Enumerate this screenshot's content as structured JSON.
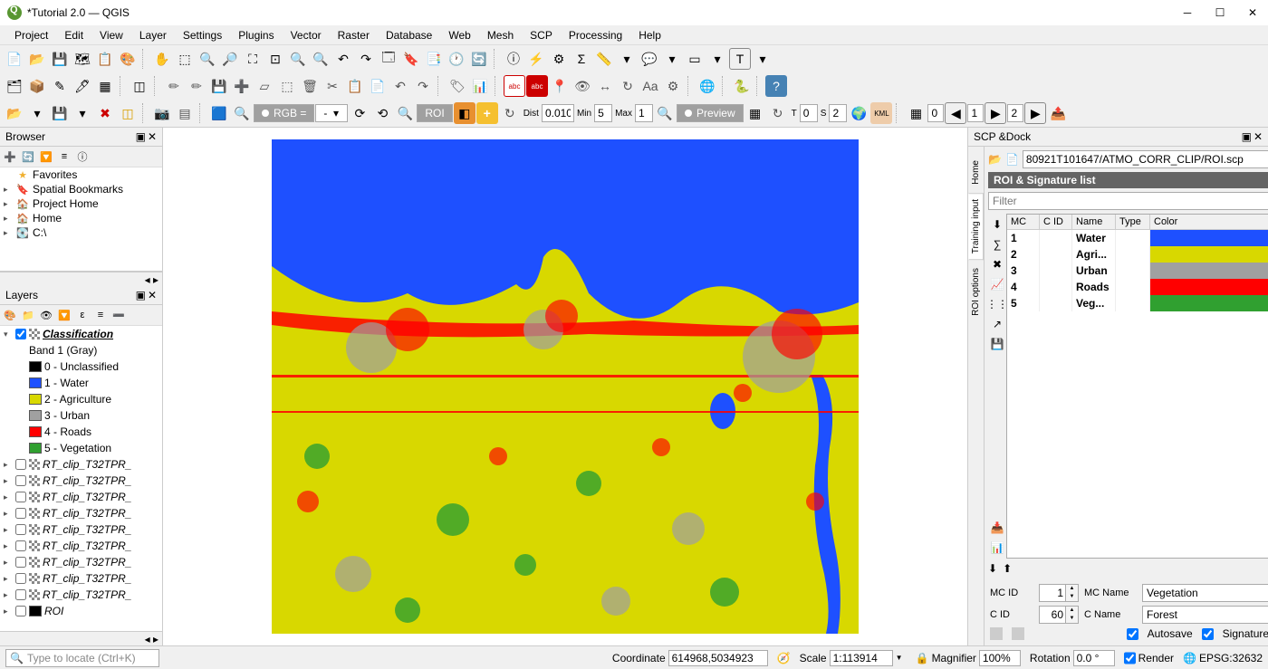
{
  "window": {
    "title": "*Tutorial 2.0 — QGIS"
  },
  "menus": [
    "Project",
    "Edit",
    "View",
    "Layer",
    "Settings",
    "Plugins",
    "Vector",
    "Raster",
    "Database",
    "Web",
    "Mesh",
    "SCP",
    "Processing",
    "Help"
  ],
  "toolbar3": {
    "rgb_label": "RGB = ",
    "roi_label": "ROI",
    "dist_label": "Dist",
    "dist_val": "0.010",
    "min_label": "Min",
    "min_val": "5",
    "max_label": "Max",
    "max_val": "1",
    "preview_label": "Preview",
    "s_label": "S",
    "s_val": "2",
    "t_label": "T",
    "t_val": "0"
  },
  "browser": {
    "title": "Browser",
    "items": [
      {
        "icon": "star",
        "label": "Favorites",
        "color": "#f0b030"
      },
      {
        "icon": "bookmark",
        "label": "Spatial Bookmarks",
        "color": "#888"
      },
      {
        "icon": "home",
        "label": "Project Home",
        "color": "#4a9"
      },
      {
        "icon": "home2",
        "label": "Home",
        "color": "#888"
      },
      {
        "icon": "drive",
        "label": "C:\\",
        "color": "#888"
      }
    ]
  },
  "layers": {
    "title": "Layers",
    "classification": {
      "name": "Classification",
      "band": "Band 1 (Gray)"
    },
    "classes": [
      {
        "label": "0 - Unclassified",
        "color": "#000000"
      },
      {
        "label": "1 - Water",
        "color": "#1e50ff"
      },
      {
        "label": "2 - Agriculture",
        "color": "#d8d800"
      },
      {
        "label": "3 - Urban",
        "color": "#a0a0a0"
      },
      {
        "label": "4 - Roads",
        "color": "#ff0000"
      },
      {
        "label": "5 - Vegetation",
        "color": "#30a030"
      }
    ],
    "rt_layers": [
      "RT_clip_T32TPR_",
      "RT_clip_T32TPR_",
      "RT_clip_T32TPR_",
      "RT_clip_T32TPR_",
      "RT_clip_T32TPR_",
      "RT_clip_T32TPR_",
      "RT_clip_T32TPR_",
      "RT_clip_T32TPR_",
      "RT_clip_T32TPR_"
    ],
    "roi_layer": "ROI"
  },
  "scp": {
    "title": "SCP &Dock",
    "tabs": [
      "Home",
      "Training input",
      "ROI options"
    ],
    "file_path": "80921T101647/ATMO_CORR_CLIP/ROI.scp",
    "sig_header": "ROI & Signature list",
    "filter_placeholder": "Filter",
    "columns": [
      "MC",
      "C ID",
      "Name",
      "Type",
      "Color"
    ],
    "rows": [
      {
        "mc": "1",
        "cid": "",
        "name": "Water",
        "type": "",
        "color": "#1e50ff"
      },
      {
        "mc": "2",
        "cid": "",
        "name": "Agri...",
        "type": "",
        "color": "#d8d800"
      },
      {
        "mc": "3",
        "cid": "",
        "name": "Urban",
        "type": "",
        "color": "#a0a0a0"
      },
      {
        "mc": "4",
        "cid": "",
        "name": "Roads",
        "type": "",
        "color": "#ff0000"
      },
      {
        "mc": "5",
        "cid": "",
        "name": "Veg...",
        "type": "",
        "color": "#30a030"
      }
    ],
    "mcid_label": "MC ID",
    "mcid_val": "1",
    "mcname_label": "MC Name",
    "mcname_val": "Vegetation",
    "cid_label": "C ID",
    "cid_val": "60",
    "cname_label": "C Name",
    "cname_val": "Forest",
    "autosave": "Autosave",
    "signature": "Signature"
  },
  "status": {
    "locator_placeholder": "Type to locate (Ctrl+K)",
    "coord_label": "Coordinate",
    "coord_val": "614968,5034923",
    "scale_label": "Scale",
    "scale_val": "1:113914",
    "mag_label": "Magnifier",
    "mag_val": "100%",
    "rot_label": "Rotation",
    "rot_val": "0.0 °",
    "render": "Render",
    "epsg": "EPSG:32632"
  },
  "spinners": {
    "a": "0",
    "b": "1",
    "c": "2"
  }
}
